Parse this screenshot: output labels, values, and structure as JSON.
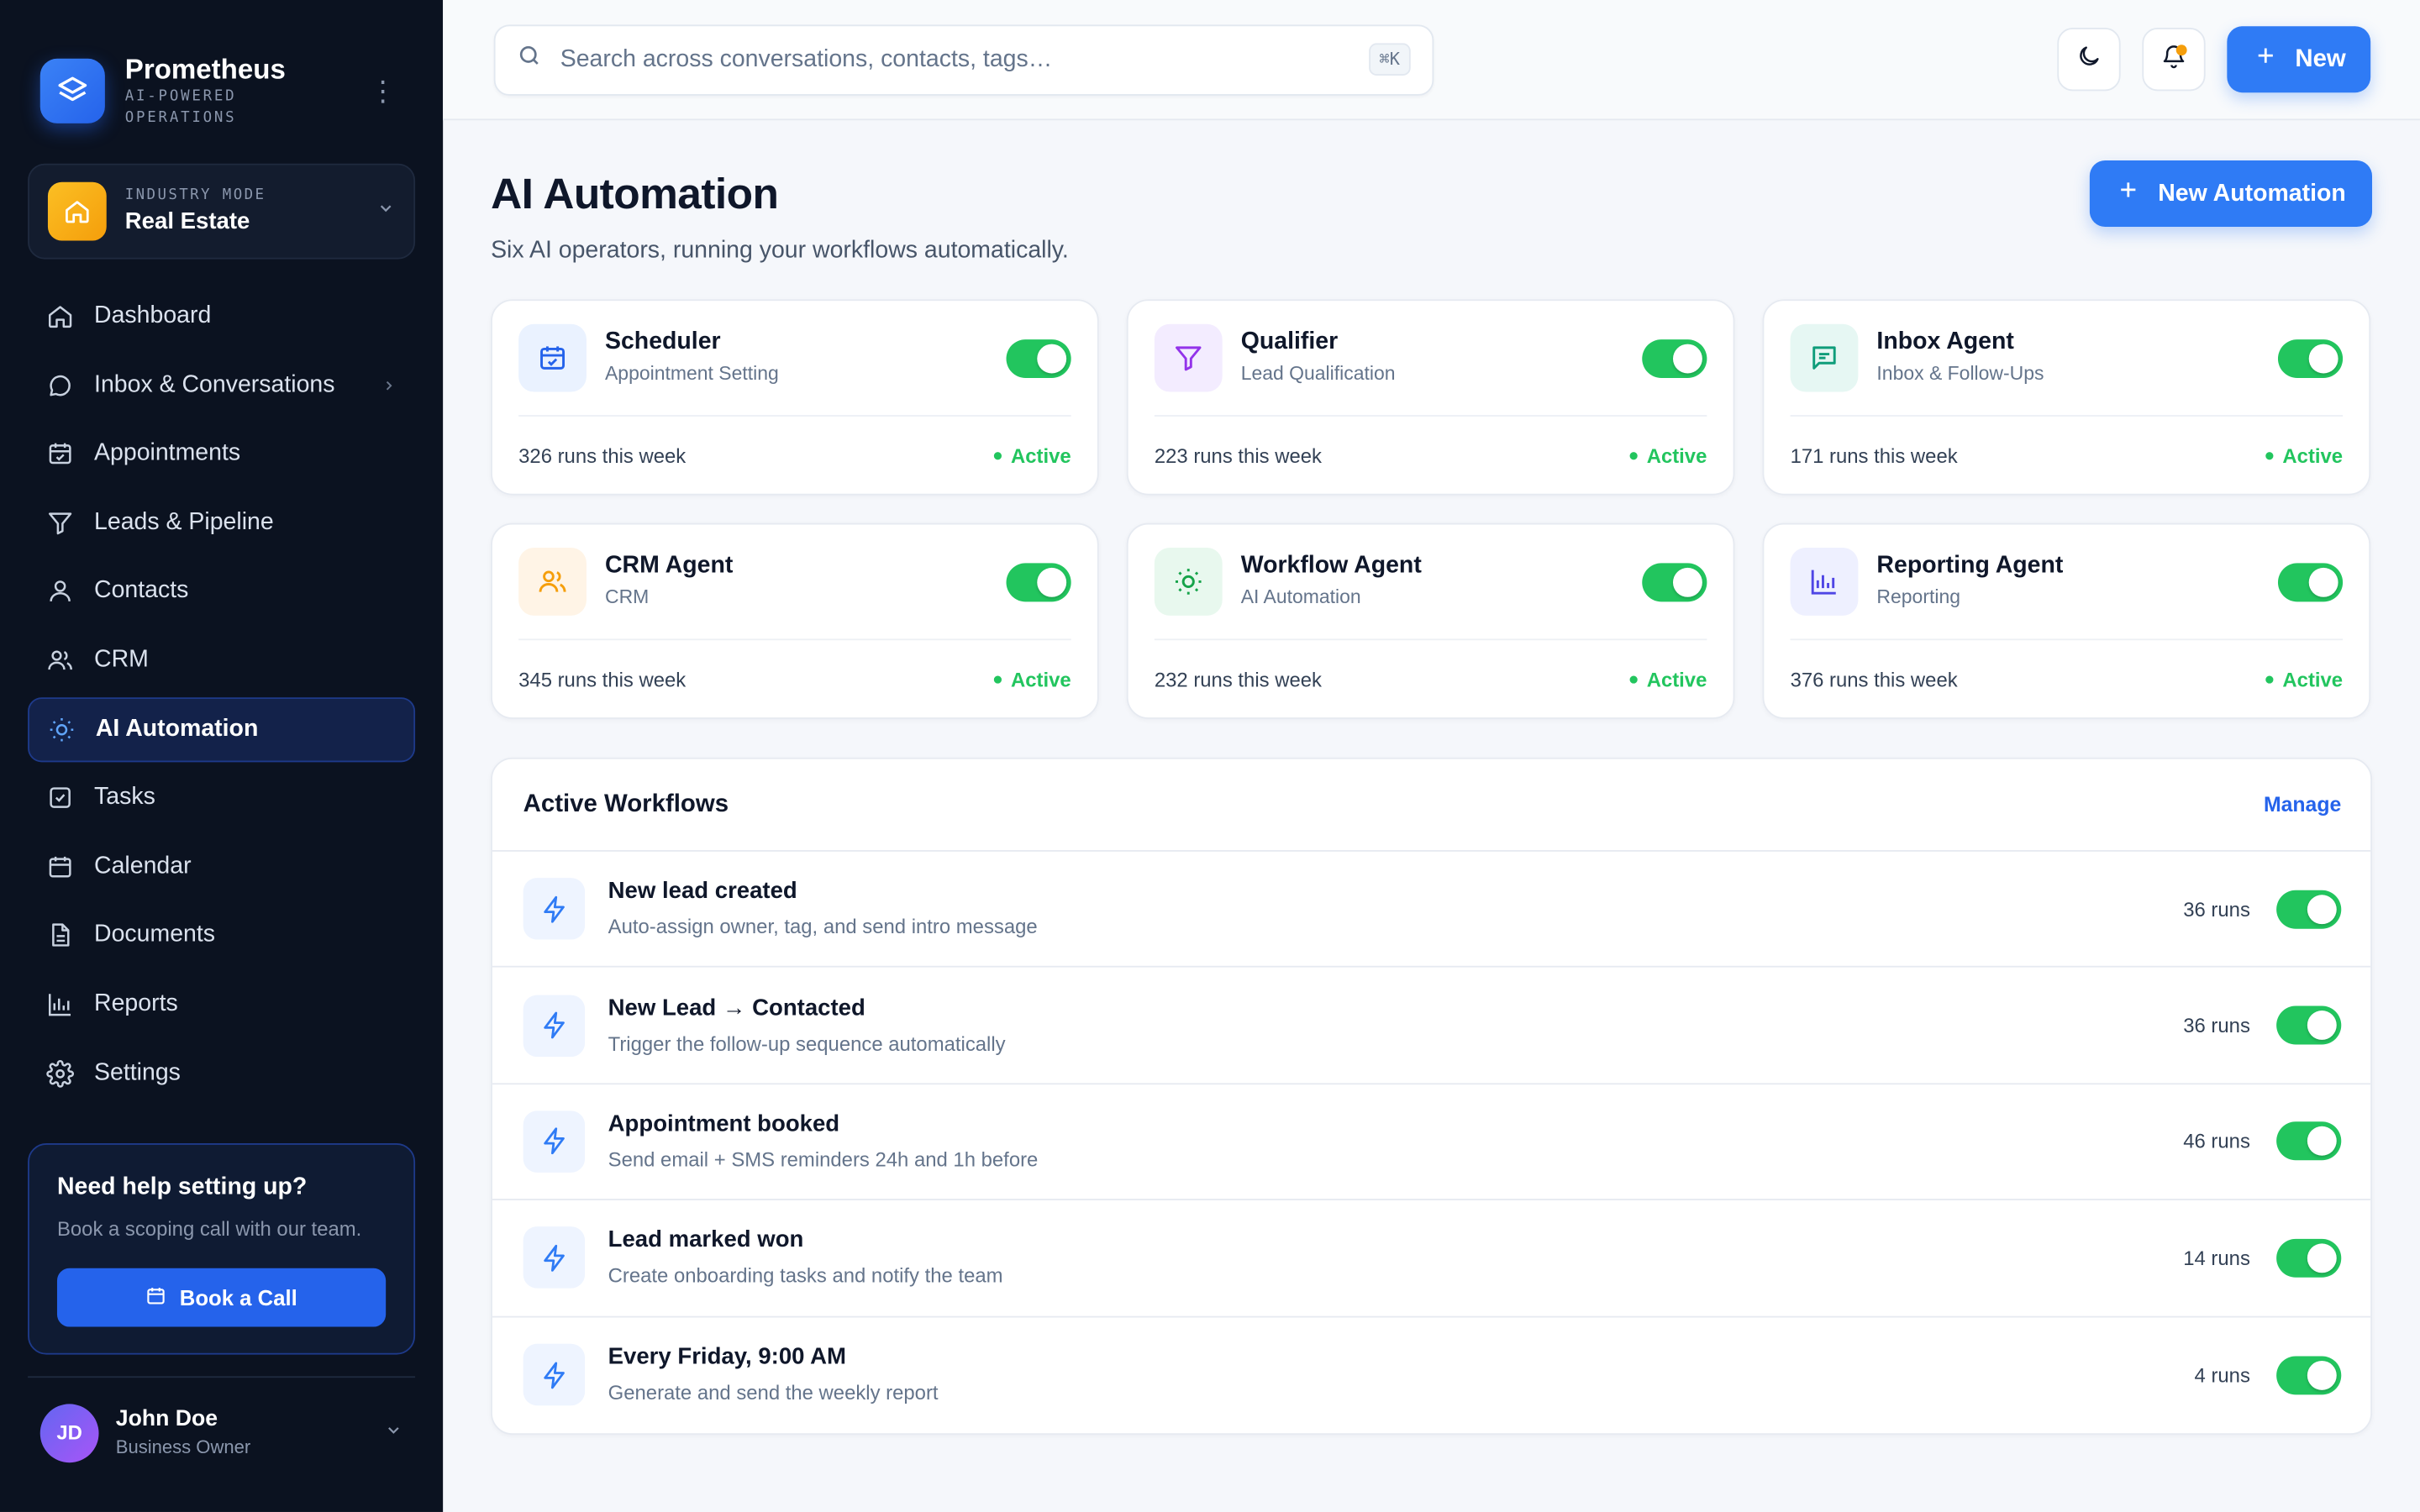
{
  "brand": {
    "name": "Prometheus",
    "tagline": "AI-POWERED OPERATIONS"
  },
  "industry": {
    "label": "INDUSTRY MODE",
    "value": "Real Estate"
  },
  "nav": [
    {
      "label": "Dashboard",
      "icon": "home-icon"
    },
    {
      "label": "Inbox & Conversations",
      "icon": "chat-icon",
      "has_submenu": true
    },
    {
      "label": "Appointments",
      "icon": "calendar-check-icon"
    },
    {
      "label": "Leads & Pipeline",
      "icon": "filter-icon"
    },
    {
      "label": "Contacts",
      "icon": "user-icon"
    },
    {
      "label": "CRM",
      "icon": "users-icon"
    },
    {
      "label": "AI Automation",
      "icon": "sun-icon",
      "active": true
    },
    {
      "label": "Tasks",
      "icon": "checkbox-icon"
    },
    {
      "label": "Calendar",
      "icon": "calendar-icon"
    },
    {
      "label": "Documents",
      "icon": "document-icon"
    },
    {
      "label": "Reports",
      "icon": "bar-chart-icon"
    },
    {
      "label": "Settings",
      "icon": "gear-icon"
    }
  ],
  "help": {
    "title": "Need help setting up?",
    "subtitle": "Book a scoping call with our team.",
    "button": "Book a Call"
  },
  "user": {
    "initials": "JD",
    "name": "John Doe",
    "role": "Business Owner"
  },
  "topbar": {
    "search_placeholder": "Search across conversations, contacts, tags…",
    "shortcut": "⌘K",
    "new_button": "New"
  },
  "page": {
    "title": "AI Automation",
    "subtitle": "Six AI operators, running your workflows automatically.",
    "new_automation_button": "New Automation"
  },
  "agents": [
    {
      "name": "Scheduler",
      "category": "Appointment Setting",
      "runs": "326 runs this week",
      "status": "Active",
      "enabled": true,
      "icon": "calendar-check-icon",
      "icon_bg": "#eaf2ff",
      "icon_color": "#2563eb"
    },
    {
      "name": "Qualifier",
      "category": "Lead Qualification",
      "runs": "223 runs this week",
      "status": "Active",
      "enabled": true,
      "icon": "filter-icon",
      "icon_bg": "#f3ecff",
      "icon_color": "#9333ea"
    },
    {
      "name": "Inbox Agent",
      "category": "Inbox & Follow-Ups",
      "runs": "171 runs this week",
      "status": "Active",
      "enabled": true,
      "icon": "message-icon",
      "icon_bg": "#e6f7f3",
      "icon_color": "#0f9d7a"
    },
    {
      "name": "CRM Agent",
      "category": "CRM",
      "runs": "345 runs this week",
      "status": "Active",
      "enabled": true,
      "icon": "users-icon",
      "icon_bg": "#fff4e6",
      "icon_color": "#f59e0b"
    },
    {
      "name": "Workflow Agent",
      "category": "AI Automation",
      "runs": "232 runs this week",
      "status": "Active",
      "enabled": true,
      "icon": "sun-icon",
      "icon_bg": "#e8f8ee",
      "icon_color": "#16a34a"
    },
    {
      "name": "Reporting Agent",
      "category": "Reporting",
      "runs": "376 runs this week",
      "status": "Active",
      "enabled": true,
      "icon": "bar-chart-icon",
      "icon_bg": "#eef0ff",
      "icon_color": "#4f46e5"
    }
  ],
  "workflows": {
    "title": "Active Workflows",
    "manage": "Manage",
    "items": [
      {
        "name": "New lead created",
        "description": "Auto-assign owner, tag, and send intro message",
        "runs": "36 runs",
        "enabled": true
      },
      {
        "name": "New Lead → Contacted",
        "description": "Trigger the follow-up sequence automatically",
        "runs": "36 runs",
        "enabled": true
      },
      {
        "name": "Appointment booked",
        "description": "Send email + SMS reminders 24h and 1h before",
        "runs": "46 runs",
        "enabled": true
      },
      {
        "name": "Lead marked won",
        "description": "Create onboarding tasks and notify the team",
        "runs": "14 runs",
        "enabled": true
      },
      {
        "name": "Every Friday, 9:00 AM",
        "description": "Generate and send the weekly report",
        "runs": "4 runs",
        "enabled": true
      }
    ]
  },
  "colors": {
    "accent": "#2f7bf5",
    "success": "#22c55e",
    "sidebar_bg": "#0b1220"
  }
}
